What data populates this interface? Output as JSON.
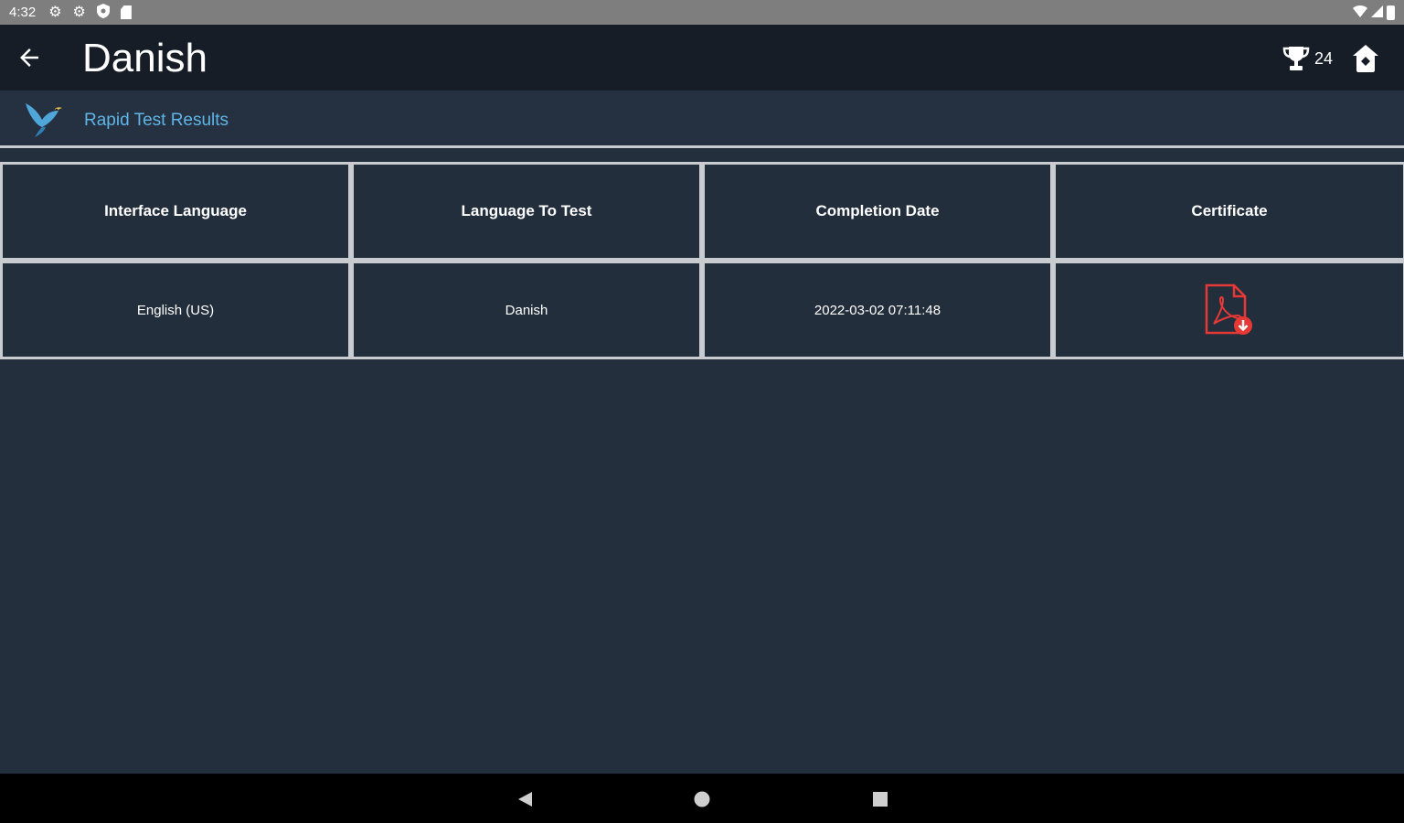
{
  "status_bar": {
    "time": "4:32"
  },
  "app_bar": {
    "title": "Danish",
    "trophy_count": "24"
  },
  "subheader": {
    "title": "Rapid Test Results"
  },
  "table": {
    "headers": [
      "Interface Language",
      "Language To Test",
      "Completion Date",
      "Certificate"
    ],
    "rows": [
      {
        "interface_language": "English (US)",
        "language_to_test": "Danish",
        "completion_date": "2022-03-02 07:11:48",
        "certificate_icon": "pdf-download-icon"
      }
    ]
  },
  "colors": {
    "background": "#242f3d",
    "app_bar": "#161d26",
    "accent_blue": "#5fb5e6",
    "pdf_red": "#e53935",
    "grid_lines": "#c8ccd0"
  }
}
